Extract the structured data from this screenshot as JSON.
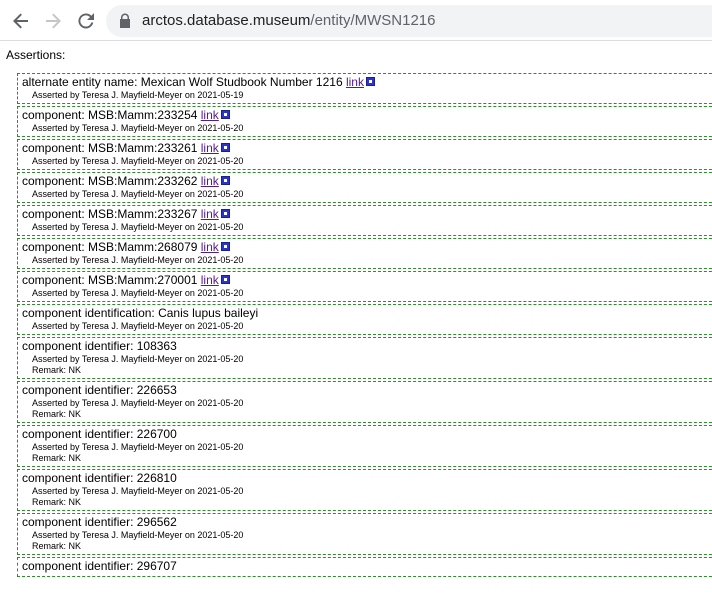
{
  "browser": {
    "url_host": "arctos.database.museum",
    "url_path": "/entity/MWSN1216"
  },
  "page": {
    "section_label": "Assertions:",
    "link_label": "link"
  },
  "assertions": [
    {
      "text": "alternate entity name: Mexican Wolf Studbook Number 1216 ",
      "asserted": "Asserted by Teresa J. Mayfield-Meyer on 2021-05-19",
      "has_link": true
    },
    {
      "text": "component: MSB:Mamm:233254 ",
      "asserted": "Asserted by Teresa J. Mayfield-Meyer on 2021-05-20",
      "has_link": true
    },
    {
      "text": "component: MSB:Mamm:233261 ",
      "asserted": "Asserted by Teresa J. Mayfield-Meyer on 2021-05-20",
      "has_link": true
    },
    {
      "text": "component: MSB:Mamm:233262 ",
      "asserted": "Asserted by Teresa J. Mayfield-Meyer on 2021-05-20",
      "has_link": true
    },
    {
      "text": "component: MSB:Mamm:233267 ",
      "asserted": "Asserted by Teresa J. Mayfield-Meyer on 2021-05-20",
      "has_link": true
    },
    {
      "text": "component: MSB:Mamm:268079 ",
      "asserted": "Asserted by Teresa J. Mayfield-Meyer on 2021-05-20",
      "has_link": true
    },
    {
      "text": "component: MSB:Mamm:270001 ",
      "asserted": "Asserted by Teresa J. Mayfield-Meyer on 2021-05-20",
      "has_link": true
    },
    {
      "text": "component identification: Canis lupus baileyi",
      "asserted": "Asserted by Teresa J. Mayfield-Meyer on 2021-05-20",
      "has_link": false
    },
    {
      "text": "component identifier: 108363",
      "asserted": "Asserted by Teresa J. Mayfield-Meyer on 2021-05-20",
      "remark": "Remark: NK",
      "has_link": false
    },
    {
      "text": "component identifier: 226653",
      "asserted": "Asserted by Teresa J. Mayfield-Meyer on 2021-05-20",
      "remark": "Remark: NK",
      "has_link": false
    },
    {
      "text": "component identifier: 226700",
      "asserted": "Asserted by Teresa J. Mayfield-Meyer on 2021-05-20",
      "remark": "Remark: NK",
      "has_link": false
    },
    {
      "text": "component identifier: 226810",
      "asserted": "Asserted by Teresa J. Mayfield-Meyer on 2021-05-20",
      "remark": "Remark: NK",
      "has_link": false
    },
    {
      "text": "component identifier: 296562",
      "asserted": "Asserted by Teresa J. Mayfield-Meyer on 2021-05-20",
      "remark": "Remark: NK",
      "has_link": false
    },
    {
      "text": "component identifier: 296707",
      "asserted": "",
      "has_link": false
    }
  ]
}
